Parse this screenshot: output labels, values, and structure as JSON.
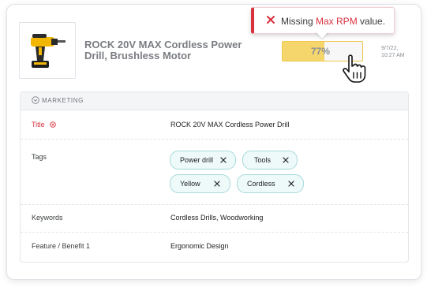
{
  "product": {
    "title": "ROCK 20V MAX Cordless Power Drill, Brushless Motor",
    "completeness": "77%",
    "completeness_fraction": 0.52,
    "date_line1": "9/7/22,",
    "date_line2": "10:27 AM"
  },
  "toast": {
    "prefix": "Missing ",
    "field": "Max RPM",
    "suffix": " value."
  },
  "section": {
    "label": "MARKETING"
  },
  "fields": {
    "title": {
      "label": "Title",
      "value": "ROCK 20V MAX Cordless Power Drill"
    },
    "tags": {
      "label": "Tags",
      "items": [
        "Power drill",
        "Tools",
        "Yellow",
        "Cordless"
      ]
    },
    "keywords": {
      "label": "Keywords",
      "value": "Cordless Drills, Woodworking"
    },
    "feature": {
      "label": "Feature / Benefit 1",
      "value": "Ergonomic Design"
    }
  },
  "colors": {
    "accent_red": "#d9323f",
    "progress_yellow": "#f5d66c",
    "tag_border": "#a8d9da"
  },
  "icons": [
    "close-icon",
    "chevron-down-icon",
    "alert-circle-icon",
    "hand-pointer-icon"
  ]
}
